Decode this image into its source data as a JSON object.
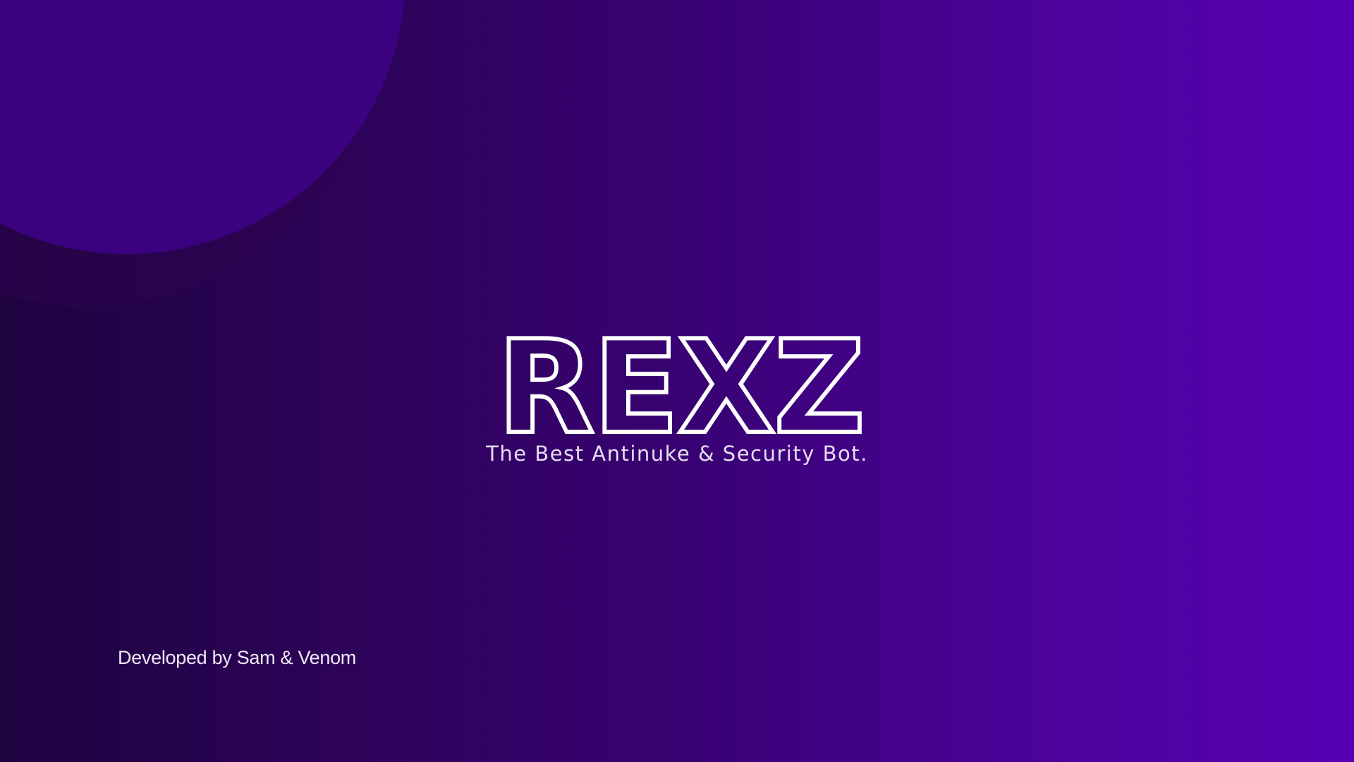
{
  "banner": {
    "logo_text": "REXZ",
    "tagline": "The Best Antinuke & Security Bot.",
    "credits": "Developed by Sam & Venom"
  },
  "colors": {
    "gradient_start": "#1e0340",
    "gradient_end": "#5600b3",
    "logo_stroke": "#ffffff",
    "tagline_text": "#e6dcf2"
  }
}
